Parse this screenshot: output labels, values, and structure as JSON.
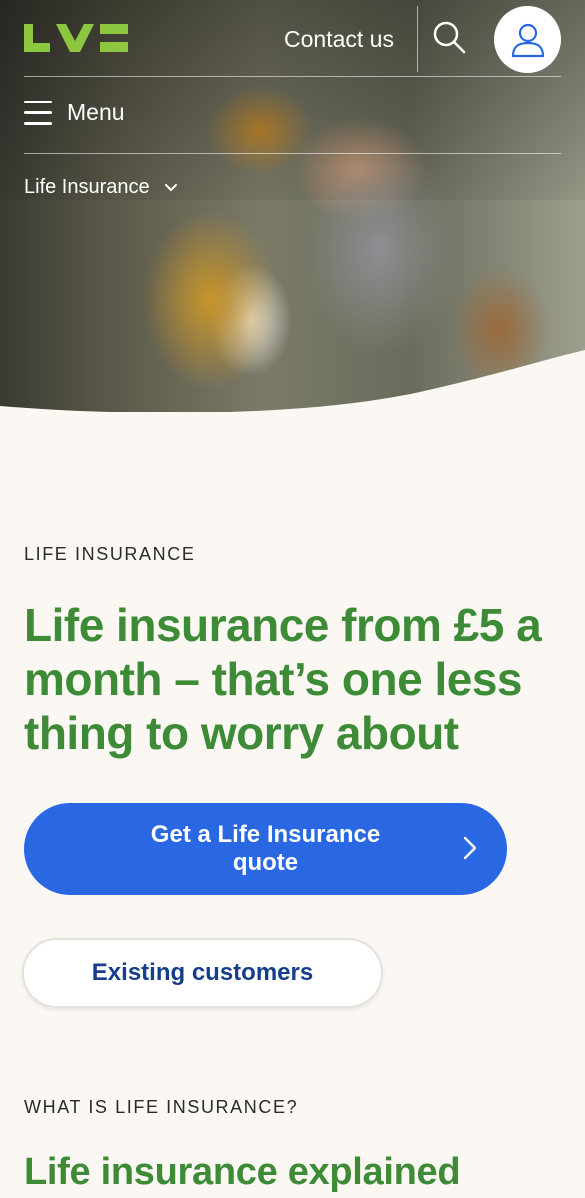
{
  "header": {
    "logo_text": "LV=",
    "contact_label": "Contact us",
    "search_icon": "search-icon",
    "account_icon": "user-icon",
    "menu_label": "Menu",
    "breadcrumb_label": "Life Insurance"
  },
  "hero": {
    "eyebrow": "LIFE INSURANCE",
    "headline": "Life insurance from £5 a month – that’s one less thing to worry about",
    "primary_cta": "Get a Life Insurance quote",
    "secondary_cta": "Existing customers"
  },
  "section": {
    "eyebrow": "WHAT IS LIFE INSURANCE?",
    "heading": "Life insurance explained"
  },
  "colors": {
    "brand_green": "#3d8b37",
    "logo_green": "#8dc63f",
    "primary_blue": "#2a67e2",
    "navy": "#173e8a",
    "background": "#fbf8f3"
  }
}
